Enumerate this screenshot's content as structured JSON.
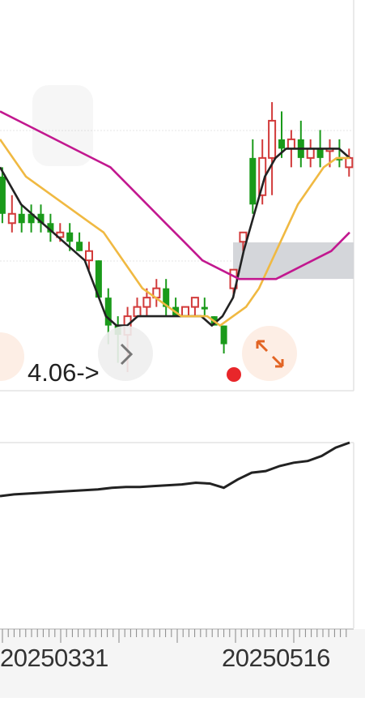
{
  "chart_data": {
    "type": "candlestick",
    "x_axis_labels": [
      "20250331",
      "20250516"
    ],
    "annotation": "4.06->",
    "candles": [
      {
        "o": 4.22,
        "h": 4.26,
        "c": 4.2,
        "l": 4.18,
        "up": false
      },
      {
        "o": 4.2,
        "h": 4.21,
        "c": 4.16,
        "l": 4.15,
        "up": false
      },
      {
        "o": 4.16,
        "h": 4.18,
        "c": 4.15,
        "l": 4.14,
        "up": true
      },
      {
        "o": 4.16,
        "h": 4.17,
        "c": 4.15,
        "l": 4.14,
        "up": false
      },
      {
        "o": 4.16,
        "h": 4.17,
        "c": 4.15,
        "l": 4.14,
        "up": false
      },
      {
        "o": 4.16,
        "h": 4.17,
        "c": 4.15,
        "l": 4.14,
        "up": false
      },
      {
        "o": 4.15,
        "h": 4.16,
        "c": 4.14,
        "l": 4.13,
        "up": false
      },
      {
        "o": 4.14,
        "h": 4.15,
        "c": 4.135,
        "l": 4.13,
        "up": true
      },
      {
        "o": 4.14,
        "h": 4.15,
        "c": 4.13,
        "l": 4.12,
        "up": false
      },
      {
        "o": 4.13,
        "h": 4.14,
        "c": 4.12,
        "l": 4.12,
        "up": false
      },
      {
        "o": 4.12,
        "h": 4.13,
        "c": 4.11,
        "l": 4.1,
        "up": true
      },
      {
        "o": 4.11,
        "h": 4.11,
        "c": 4.07,
        "l": 4.07,
        "up": false
      },
      {
        "o": 4.07,
        "h": 4.08,
        "c": 4.04,
        "l": 4.02,
        "up": false
      },
      {
        "o": 4.04,
        "h": 4.05,
        "c": 4.03,
        "l": 4.0,
        "up": false
      },
      {
        "o": 4.03,
        "h": 4.06,
        "c": 4.05,
        "l": 3.99,
        "up": true
      },
      {
        "o": 4.05,
        "h": 4.07,
        "c": 4.06,
        "l": 4.05,
        "up": true
      },
      {
        "o": 4.06,
        "h": 4.08,
        "c": 4.07,
        "l": 4.05,
        "up": true
      },
      {
        "o": 4.07,
        "h": 4.09,
        "c": 4.08,
        "l": 4.06,
        "up": true
      },
      {
        "o": 4.08,
        "h": 4.09,
        "c": 4.06,
        "l": 4.05,
        "up": false
      },
      {
        "o": 4.06,
        "h": 4.07,
        "c": 4.05,
        "l": 4.05,
        "up": false
      },
      {
        "o": 4.05,
        "h": 4.06,
        "c": 4.06,
        "l": 4.05,
        "up": true
      },
      {
        "o": 4.06,
        "h": 4.07,
        "c": 4.07,
        "l": 4.05,
        "up": true
      },
      {
        "o": 4.06,
        "h": 4.07,
        "c": 4.06,
        "l": 4.05,
        "up": false
      },
      {
        "o": 4.05,
        "h": 4.05,
        "c": 4.04,
        "l": 4.04,
        "up": false
      },
      {
        "o": 4.04,
        "h": 4.04,
        "c": 4.02,
        "l": 4.01,
        "up": false
      },
      {
        "o": 4.08,
        "h": 4.1,
        "c": 4.1,
        "l": 4.07,
        "up": true
      },
      {
        "o": 4.13,
        "h": 4.13,
        "c": 4.14,
        "l": 4.12,
        "up": true
      },
      {
        "o": 4.17,
        "h": 4.24,
        "c": 4.22,
        "l": 4.16,
        "up": false
      },
      {
        "o": 4.18,
        "h": 4.24,
        "c": 4.22,
        "l": 4.17,
        "up": true
      },
      {
        "o": 4.22,
        "h": 4.28,
        "c": 4.26,
        "l": 4.18,
        "up": true
      },
      {
        "o": 4.24,
        "h": 4.27,
        "c": 4.23,
        "l": 4.22,
        "up": false
      },
      {
        "o": 4.23,
        "h": 4.25,
        "c": 4.24,
        "l": 4.21,
        "up": true
      },
      {
        "o": 4.24,
        "h": 4.26,
        "c": 4.22,
        "l": 4.21,
        "up": false
      },
      {
        "o": 4.22,
        "h": 4.24,
        "c": 4.23,
        "l": 4.21,
        "up": true
      },
      {
        "o": 4.23,
        "h": 4.25,
        "c": 4.22,
        "l": 4.21,
        "up": false
      },
      {
        "o": 4.23,
        "h": 4.24,
        "c": 4.23,
        "l": 4.21,
        "up": true
      },
      {
        "o": 4.22,
        "h": 4.24,
        "c": 4.22,
        "l": 4.21,
        "up": false
      },
      {
        "o": 4.22,
        "h": 4.23,
        "c": 4.21,
        "l": 4.2,
        "up": true
      }
    ],
    "ma_lines": [
      {
        "color": "#222222",
        "values": [
          4.21,
          4.19,
          4.17,
          4.16,
          4.15,
          4.14,
          4.13,
          4.12,
          4.11,
          4.08,
          4.05,
          4.04,
          4.04,
          4.05,
          4.05,
          4.05,
          4.05,
          4.05,
          4.05,
          4.05,
          4.04,
          4.05,
          4.07,
          4.12,
          4.16,
          4.2,
          4.22,
          4.23,
          4.23,
          4.23,
          4.23,
          4.23,
          4.23,
          4.22
        ]
      },
      {
        "color": "#f0b942",
        "values": [
          4.24,
          4.22,
          4.2,
          4.19,
          4.18,
          4.17,
          4.16,
          4.15,
          4.14,
          4.12,
          4.1,
          4.08,
          4.07,
          4.06,
          4.05,
          4.05,
          4.05,
          4.04,
          4.05,
          4.06,
          4.08,
          4.11,
          4.14,
          4.17,
          4.19,
          4.21,
          4.22,
          4.22
        ]
      },
      {
        "color": "#c2188f",
        "values": [
          4.27,
          4.26,
          4.25,
          4.24,
          4.23,
          4.22,
          4.21,
          4.19,
          4.17,
          4.15,
          4.13,
          4.11,
          4.1,
          4.09,
          4.09,
          4.09,
          4.1,
          4.11,
          4.12,
          4.14
        ]
      }
    ],
    "volume_line": [
      0.36,
      0.38,
      0.39,
      0.4,
      0.41,
      0.42,
      0.43,
      0.44,
      0.46,
      0.47,
      0.47,
      0.48,
      0.49,
      0.5,
      0.52,
      0.51,
      0.46,
      0.56,
      0.64,
      0.66,
      0.72,
      0.76,
      0.78,
      0.84,
      0.94,
      1.0
    ]
  }
}
